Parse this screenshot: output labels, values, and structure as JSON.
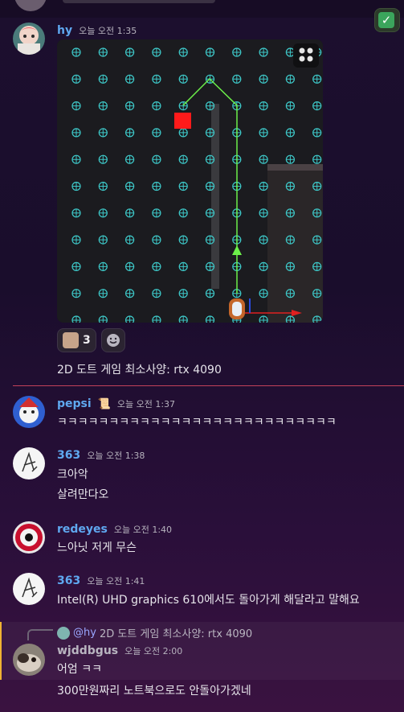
{
  "top_reaction": {
    "emoji_name": "white-check-mark"
  },
  "messages": [
    {
      "username": "hy",
      "username_color": "#5fa8f0",
      "timestamp": "오늘 오전 1:35",
      "reaction_count": "3",
      "text": "2D 도트 게임 최소사양: rtx 4090"
    },
    {
      "username": "pepsi",
      "username_color": "#5fa8f0",
      "badge": "📜",
      "timestamp": "오늘 오전 1:37",
      "text": "ㅋㅋㅋㅋㅋㅋㅋㅋㅋㅋㅋㅋㅋㅋㅋㅋㅋㅋㅋㅋㅋㅋㅋㅋㅋㅋㅋ"
    },
    {
      "username": "363",
      "username_color": "#5fa8f0",
      "timestamp": "오늘 오전 1:38",
      "lines": [
        "크아악",
        "살려만다오"
      ]
    },
    {
      "username": "redeyes",
      "username_color": "#5fa8f0",
      "timestamp": "오늘 오전 1:40",
      "text": "느아닛 저게 무슨"
    },
    {
      "username": "363",
      "username_color": "#5fa8f0",
      "timestamp": "오늘 오전 1:41",
      "text": "Intel(R) UHD graphics 610에서도 돌아가게 해달라고 말해요"
    },
    {
      "username": "wjddbgus",
      "username_color": "#b9b5c0",
      "timestamp": "오늘 오전 2:00",
      "reply_mention": "@hy",
      "reply_text": "2D 도트 게임 최소사양: rtx 4090",
      "lines": [
        "어엄 ㅋㅋ",
        "300만원짜리 노트북으로도 안돌아가겠네"
      ]
    }
  ],
  "colors": {
    "new_divider": "#c3425a",
    "grid_marker": "#3ec9c9",
    "path": "#6cf04a",
    "target": "#ff1a1a"
  }
}
